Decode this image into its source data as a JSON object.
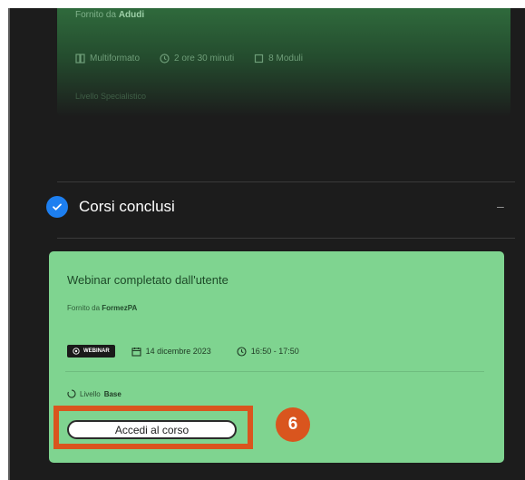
{
  "top_card": {
    "provider_prefix": "Fornito da",
    "provider_name": "Adudi",
    "format": "Multiformato",
    "duration": "2 ore 30 minuti",
    "modules": "8 Moduli",
    "level": "Livello Specialistico"
  },
  "completed_section": {
    "title": "Corsi conclusi",
    "collapse_symbol": "–"
  },
  "course": {
    "title": "Webinar completato dall'utente",
    "provider_prefix": "Fornito da",
    "provider_name": "FormezPA",
    "badge": "WEBINAR",
    "date": "14 dicembre 2023",
    "time": "16:50 - 17:50",
    "level_prefix": "Livello",
    "level_value": "Base",
    "button_label": "Accedi al corso"
  },
  "annotation": {
    "step_number": "6",
    "color": "#d9551e"
  },
  "colors": {
    "background": "#1c1c1c",
    "card_green": "#7fd490",
    "check_blue": "#1d7ff0"
  }
}
